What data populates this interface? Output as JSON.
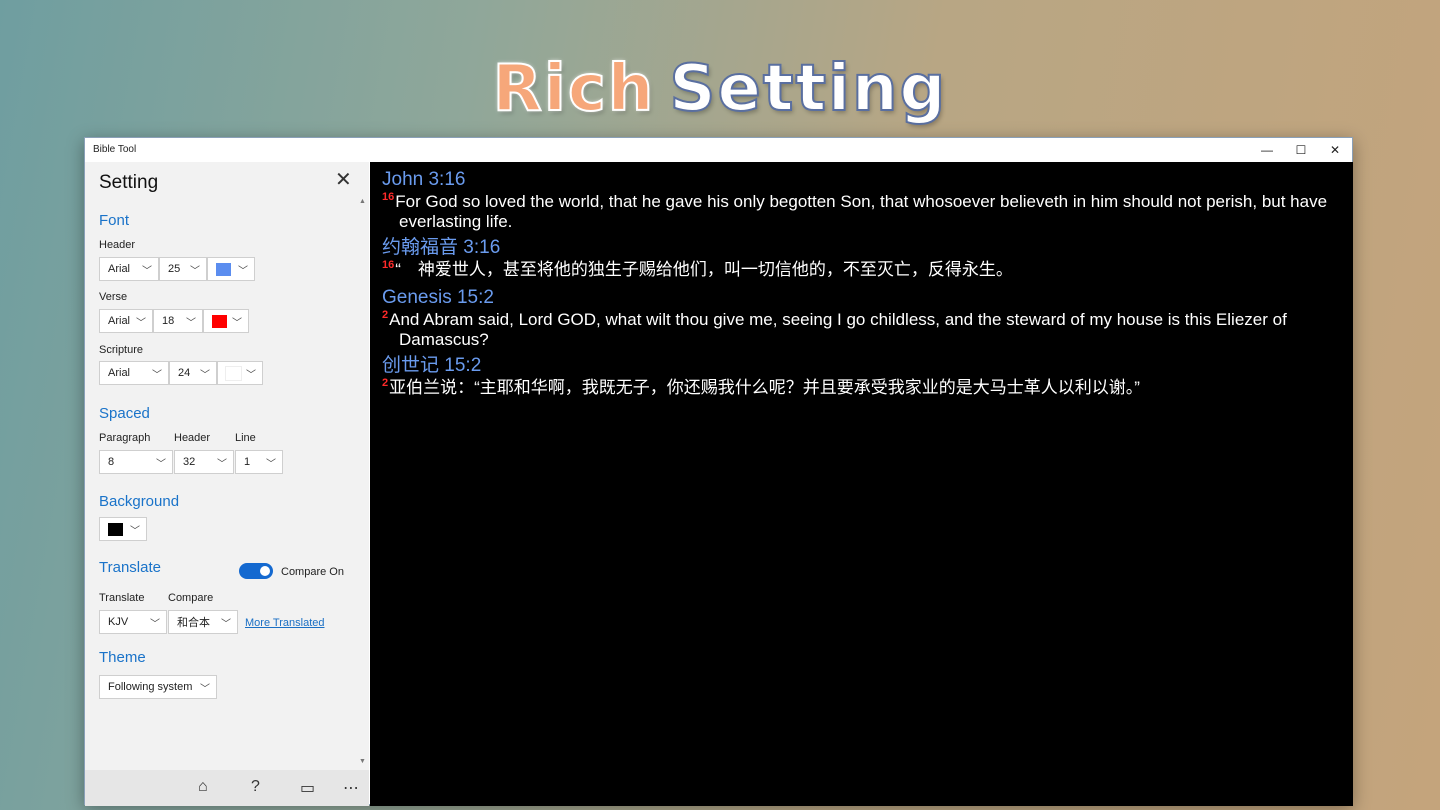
{
  "hero": {
    "word1": "Rich",
    "word2": "Setting"
  },
  "window": {
    "title": "Bible Tool",
    "minimize": "—",
    "maximize": "☐",
    "close": "✕"
  },
  "settings": {
    "title": "Setting",
    "close": "✕",
    "font": {
      "section": "Font",
      "header_label": "Header",
      "header_font": "Arial",
      "header_size": "25",
      "header_color": "#5b8def",
      "verse_label": "Verse",
      "verse_font": "Arial",
      "verse_size": "18",
      "verse_color": "#ff0000",
      "scripture_label": "Scripture",
      "scripture_font": "Arial",
      "scripture_size": "24",
      "scripture_color": "#ffffff"
    },
    "spaced": {
      "section": "Spaced",
      "paragraph_label": "Paragraph",
      "header_label": "Header",
      "line_label": "Line",
      "paragraph": "8",
      "header": "32",
      "line": "1"
    },
    "background": {
      "section": "Background",
      "color": "#000000"
    },
    "translate": {
      "section": "Translate",
      "toggle_label": "Compare On",
      "toggle_on": true,
      "translate_label": "Translate",
      "compare_label": "Compare",
      "translate_value": "KJV",
      "compare_value": "和合本",
      "more_link": "More Translated"
    },
    "theme": {
      "section": "Theme",
      "value": "Following system"
    }
  },
  "reader": {
    "passages": [
      {
        "ref": "John 3:16",
        "num": "16",
        "text": "For God so loved the world, that he gave his only begotten Son, that whosoever believeth in him should not perish, but have everlasting life."
      },
      {
        "ref": "约翰福音 3:16",
        "num": "16",
        "text": "“　神爱世人，甚至将他的独生子赐给他们，叫一切信他的，不至灭亡，反得永生。"
      },
      {
        "ref": "Genesis 15:2",
        "num": "2",
        "text": "And Abram said, Lord GOD, what wilt thou give me, seeing I go childless, and the steward of my house is this Eliezer of Damascus?"
      },
      {
        "ref": "创世记 15:2",
        "num": "2",
        "text": "亚伯兰说：“主耶和华啊，我既无子，你还赐我什么呢？并且要承受我家业的是大马士革人以利以谢。”"
      }
    ]
  },
  "bottombar": {
    "home": "⌂",
    "help": "?",
    "display": "▭",
    "more": "⋯"
  }
}
